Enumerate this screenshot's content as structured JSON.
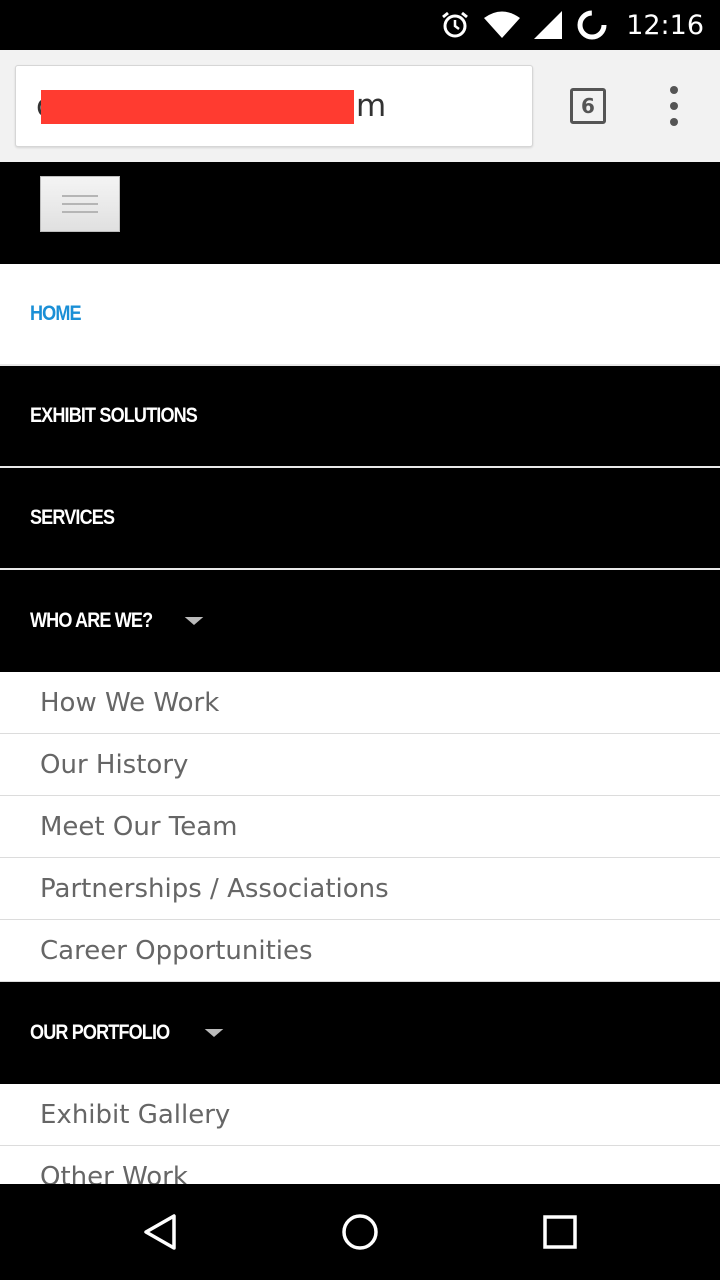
{
  "status_bar": {
    "time": "12:16",
    "icons": [
      "alarm-icon",
      "wifi-icon",
      "cell-signal-icon",
      "battery-loading-icon"
    ]
  },
  "browser": {
    "url_prefix": "c",
    "url_suffix": "m",
    "tab_count": "6",
    "icons": [
      "tab-switcher-icon",
      "overflow-menu-icon"
    ]
  },
  "site": {
    "menu_toggle_icon": "hamburger-icon",
    "nav": [
      {
        "label": "HOME",
        "active": true
      },
      {
        "label": "EXHIBIT SOLUTIONS"
      },
      {
        "label": "SERVICES"
      },
      {
        "label": "WHO ARE WE?",
        "expanded": true,
        "children": [
          "How We Work",
          "Our History",
          "Meet Our Team",
          "Partnerships / Associations",
          "Career Opportunities"
        ]
      },
      {
        "label": "OUR PORTFOLIO",
        "expanded": true,
        "children": [
          "Exhibit Gallery",
          "Other Work"
        ]
      }
    ]
  },
  "colors": {
    "active_link": "#1a8fd6",
    "nav_background": "#000000",
    "submenu_text": "#666666",
    "redaction": "#ff3b30"
  },
  "android_nav": {
    "icons": [
      "back-icon",
      "home-icon",
      "recents-icon"
    ]
  }
}
